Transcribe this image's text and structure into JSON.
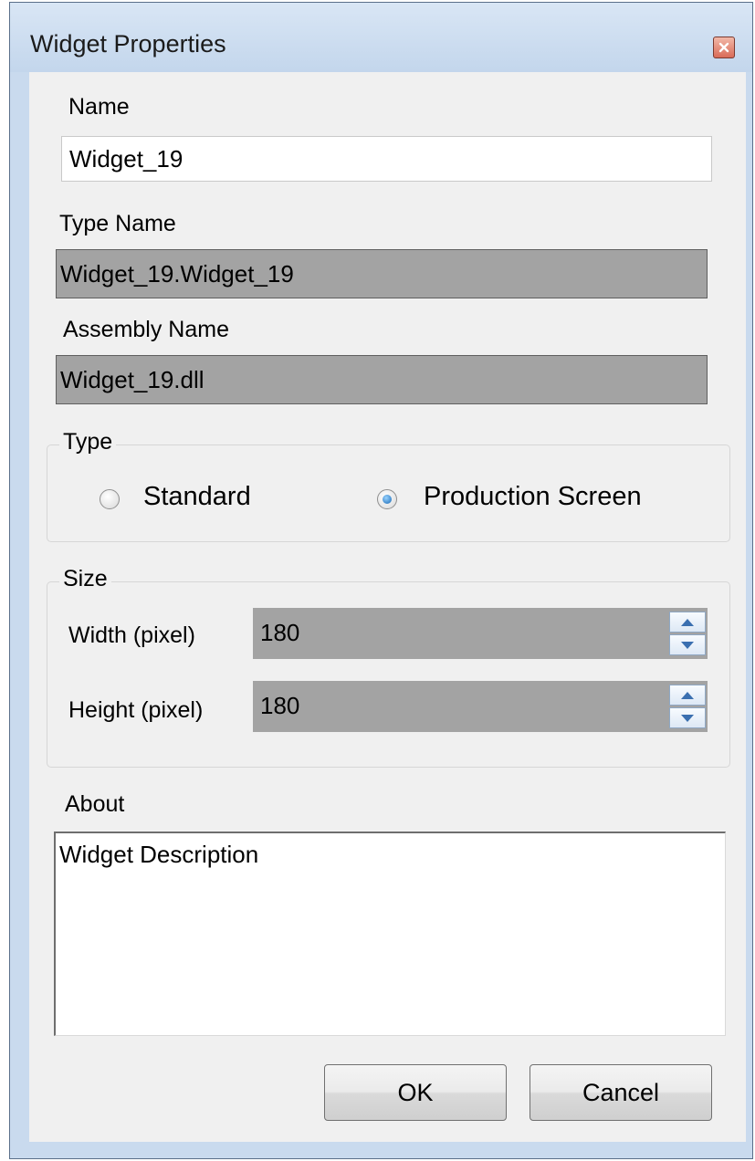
{
  "window": {
    "title": "Widget Properties"
  },
  "name": {
    "label": "Name",
    "value": "Widget_19"
  },
  "type_name": {
    "label": "Type Name",
    "value": "Widget_19.Widget_19"
  },
  "assembly_name": {
    "label": "Assembly Name",
    "value": "Widget_19.dll"
  },
  "type_group": {
    "legend": "Type",
    "options": [
      {
        "label": "Standard",
        "checked": false
      },
      {
        "label": "Production Screen",
        "checked": true
      }
    ]
  },
  "size_group": {
    "legend": "Size",
    "width_label": "Width (pixel)",
    "width_value": "180",
    "height_label": "Height (pixel)",
    "height_value": "180"
  },
  "about": {
    "label": "About",
    "value": "Widget Description"
  },
  "buttons": {
    "ok": "OK",
    "cancel": "Cancel"
  },
  "icons": {
    "close": "close-icon",
    "spin_up": "spin-up-arrow-icon",
    "spin_down": "spin-down-arrow-icon"
  },
  "colors": {
    "titlebar": "#c9daee",
    "client": "#f0f0f0",
    "disabled_field": "#a3a3a3",
    "close_button": "#d96b58",
    "radio_selected": "#1466b4"
  }
}
